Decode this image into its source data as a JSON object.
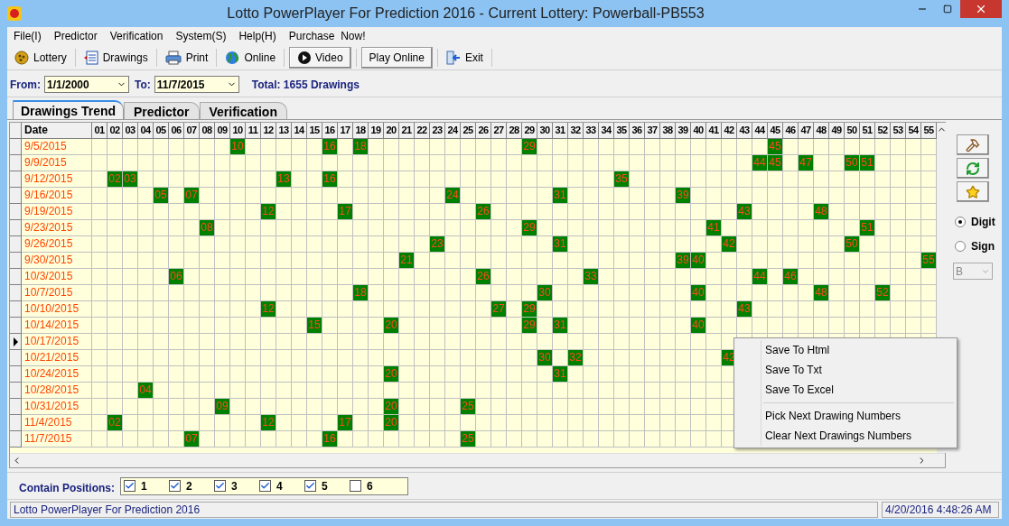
{
  "window": {
    "title": "Lotto PowerPlayer For Prediction 2016 - Current Lottery: Powerball-PB553"
  },
  "menu": [
    "File(I)",
    "Predictor",
    "Verification",
    "System(S)",
    "Help(H)",
    "Purchase  Now!"
  ],
  "toolbar": [
    {
      "label": "Lottery",
      "kind": "flat"
    },
    {
      "label": "Drawings",
      "kind": "flat"
    },
    {
      "label": "Print",
      "kind": "flat"
    },
    {
      "label": "Online",
      "kind": "flat"
    },
    {
      "label": "Video",
      "kind": "raised"
    },
    {
      "label": "Play Online",
      "kind": "raised"
    },
    {
      "label": "Exit",
      "kind": "flat"
    }
  ],
  "filter": {
    "from_label": "From:",
    "from": "1/1/2000",
    "to_label": "To:",
    "to": "11/7/2015",
    "total": "Total: 1655 Drawings"
  },
  "tabs": [
    {
      "label": "Drawings Trend",
      "selected": true
    },
    {
      "label": "Predictor",
      "selected": false
    },
    {
      "label": "Verification",
      "selected": false
    }
  ],
  "grid": {
    "columns": [
      "Date",
      "01",
      "02",
      "03",
      "04",
      "05",
      "06",
      "07",
      "08",
      "09",
      "10",
      "11",
      "12",
      "13",
      "14",
      "15",
      "16",
      "17",
      "18",
      "19",
      "20",
      "21",
      "22",
      "23",
      "24",
      "25",
      "26",
      "27",
      "28",
      "29",
      "30",
      "31",
      "32",
      "33",
      "34",
      "35",
      "36",
      "37",
      "38",
      "39",
      "40",
      "41",
      "42",
      "43",
      "44",
      "45",
      "46",
      "47",
      "48",
      "49",
      "50",
      "51",
      "52",
      "53",
      "54",
      "55"
    ],
    "rows": [
      {
        "date": "9/5/2015",
        "current": false,
        "hits": [
          "10",
          "16",
          "18",
          "29",
          "45"
        ]
      },
      {
        "date": "9/9/2015",
        "current": false,
        "hits": [
          "44",
          "45",
          "47",
          "50",
          "51"
        ]
      },
      {
        "date": "9/12/2015",
        "current": false,
        "hits": [
          "02",
          "03",
          "13",
          "16",
          "35"
        ]
      },
      {
        "date": "9/16/2015",
        "current": false,
        "hits": [
          "05",
          "07",
          "24",
          "31",
          "39"
        ]
      },
      {
        "date": "9/19/2015",
        "current": false,
        "hits": [
          "12",
          "17",
          "26",
          "43",
          "48"
        ]
      },
      {
        "date": "9/23/2015",
        "current": false,
        "hits": [
          "08",
          "29",
          "41",
          "51"
        ]
      },
      {
        "date": "9/26/2015",
        "current": false,
        "hits": [
          "23",
          "31",
          "42",
          "50"
        ]
      },
      {
        "date": "9/30/2015",
        "current": false,
        "hits": [
          "21",
          "39",
          "40",
          "55"
        ]
      },
      {
        "date": "10/3/2015",
        "current": false,
        "hits": [
          "06",
          "26",
          "33",
          "44",
          "46"
        ]
      },
      {
        "date": "10/7/2015",
        "current": false,
        "hits": [
          "18",
          "30",
          "40",
          "48",
          "52"
        ]
      },
      {
        "date": "10/10/2015",
        "current": false,
        "hits": [
          "12",
          "27",
          "29",
          "43"
        ]
      },
      {
        "date": "10/14/2015",
        "current": false,
        "hits": [
          "15",
          "20",
          "29",
          "31",
          "40"
        ]
      },
      {
        "date": "10/17/2015",
        "current": true
      },
      {
        "date": "10/21/2015",
        "current": false,
        "hits": [
          "30",
          "32",
          "42"
        ]
      },
      {
        "date": "10/24/2015",
        "current": false,
        "hits": [
          "20",
          "31"
        ]
      },
      {
        "date": "10/28/2015",
        "current": false,
        "hits": [
          "04"
        ]
      },
      {
        "date": "10/31/2015",
        "current": false,
        "hits": [
          "09",
          "20",
          "25"
        ]
      },
      {
        "date": "11/4/2015",
        "current": false,
        "hits": [
          "02",
          "12",
          "17",
          "20"
        ]
      },
      {
        "date": "11/7/2015",
        "current": false,
        "hits": [
          "07",
          "16",
          "25"
        ]
      }
    ]
  },
  "side_panel": {
    "radios": [
      {
        "label": "Digit",
        "selected": true
      },
      {
        "label": "Sign",
        "selected": false
      }
    ],
    "dropdown": {
      "value": "B",
      "disabled": true
    }
  },
  "context_menu": {
    "groups": [
      [
        "Save To Html",
        "Save To Txt",
        "Save To Excel"
      ],
      [
        "Pick Next Drawing Numbers",
        "Clear Next Drawings Numbers"
      ]
    ]
  },
  "positions": {
    "label": "Contain Positions:",
    "items": [
      {
        "label": "1",
        "checked": true
      },
      {
        "label": "2",
        "checked": true
      },
      {
        "label": "3",
        "checked": true
      },
      {
        "label": "4",
        "checked": true
      },
      {
        "label": "5",
        "checked": true
      },
      {
        "label": "6",
        "checked": false
      }
    ]
  },
  "status_bar": {
    "message": "Lotto PowerPlayer For Prediction 2016",
    "time": "4/20/2016 4:48:26 AM"
  }
}
